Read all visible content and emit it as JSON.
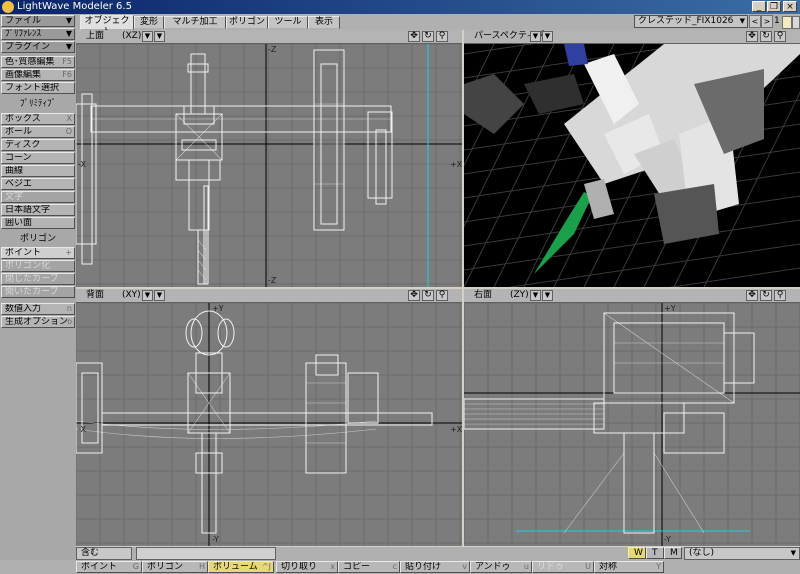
{
  "window": {
    "title": "LightWave Modeler 6.5",
    "minimize": "_",
    "restore": "❐",
    "close": "×"
  },
  "tabs": [
    "オブジェクト",
    "変形",
    "マルチ加工",
    "ポリゴン",
    "ツール",
    "表示"
  ],
  "layer": {
    "object_name": "クレステッド_FIX1026",
    "layer_number": "1"
  },
  "left_menu": {
    "file": "ファイル",
    "preferences": "ﾌﾟﾘﾌｧﾚﾝｽ",
    "plugins": "プラグイン",
    "color_edit": "色･質感編集",
    "color_edit_key": "F5",
    "image_edit": "画像編集",
    "image_edit_key": "F6",
    "font_select": "フォント選択",
    "primitive_header": "ﾌﾟﾘﾐﾃｨﾌﾞ",
    "box": "ボックス",
    "box_key": "X",
    "ball": "ボール",
    "ball_key": "O",
    "disc": "ディスク",
    "cone": "コーン",
    "curve": "曲線",
    "bezier": "ベジエ",
    "text": "文字",
    "japanese_text": "日本語文字",
    "enclose": "囲い面",
    "polygon_header": "ポリゴン",
    "point": "ポイント",
    "point_key": "+",
    "polygonize": "ポリゴン化",
    "closed_curve": "閉じたカーブ",
    "open_curve": "開いたカーブ",
    "numeric": "数値入力",
    "numeric_key": "n",
    "create_options": "生成オプション",
    "create_options_key": "o"
  },
  "viewports": {
    "top": {
      "name": "上面",
      "mode": "(XZ)",
      "axis_top": "-Z",
      "axis_right": "+X",
      "axis_left": "-X",
      "axis_bottom": "-Z"
    },
    "perspective": {
      "name": "パースペクティブ"
    },
    "back": {
      "name": "背面",
      "mode": "(XY)",
      "axis_top": "+Y",
      "axis_right": "+X",
      "axis_left": "-X",
      "axis_bottom": "-Y"
    },
    "right": {
      "name": "右面",
      "mode": "(ZY)",
      "axis_top": "+Y",
      "axis_bottom": "-Y"
    }
  },
  "status": {
    "label": "含む",
    "wtm": [
      "W",
      "T",
      "M"
    ],
    "none_value": "(なし)"
  },
  "mode_bar": {
    "point": "ポイント",
    "point_key": "G",
    "polygon": "ポリゴン",
    "polygon_key": "H",
    "volume": "ボリューム",
    "volume_key": "^J",
    "cut": "切り取り",
    "cut_key": "x",
    "copy": "コピー",
    "copy_key": "c",
    "paste": "貼り付け",
    "paste_key": "v",
    "undo": "アンドゥ",
    "undo_key": "u",
    "redo": "リドゥ",
    "redo_key": "U",
    "symmetry": "対称",
    "symmetry_key": "Y"
  },
  "colors": {
    "accent_green": "#1aa04a",
    "wire": "#ffffff",
    "grid_bg": "#7c7c7c",
    "perspective_bg": "#000000"
  }
}
